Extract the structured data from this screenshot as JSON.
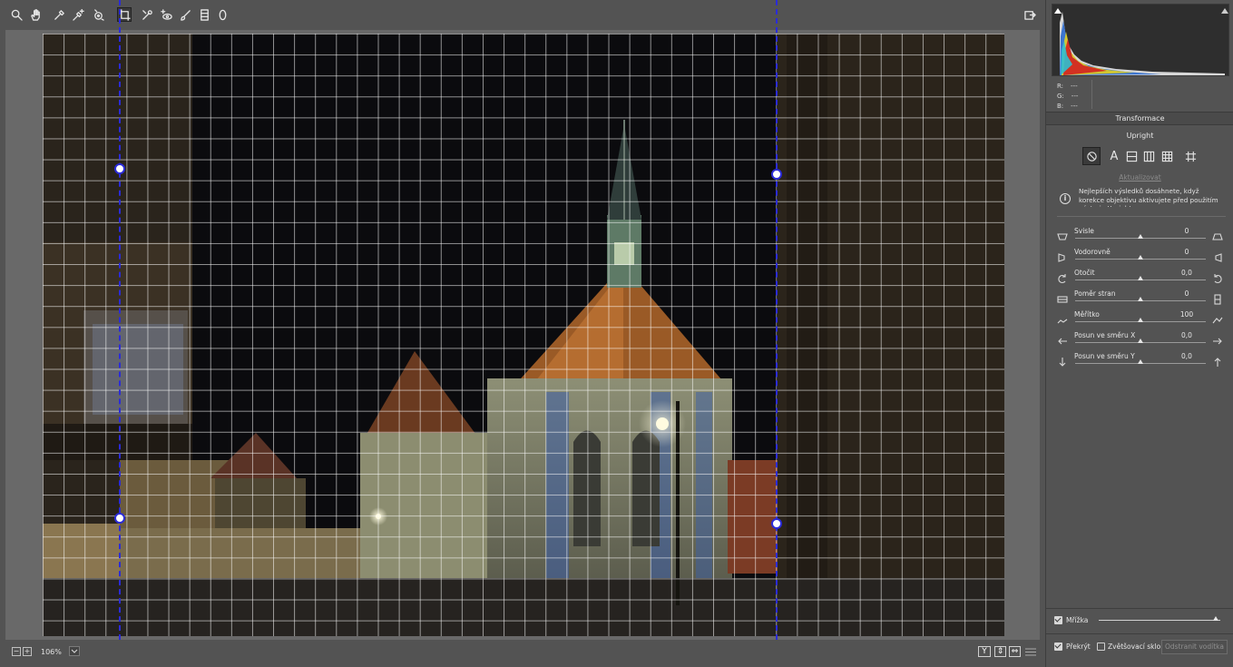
{
  "toolbar": {
    "tools": [
      {
        "id": "zoom-tool",
        "icon": "magnifier-icon"
      },
      {
        "id": "hand-tool",
        "icon": "hand-icon"
      },
      {
        "id": "white-balance-tool",
        "icon": "eyedropper-icon"
      },
      {
        "id": "color-sampler-tool",
        "icon": "eyedropper-plus-icon"
      },
      {
        "id": "targeted-adjustment-tool",
        "icon": "target-icon"
      },
      {
        "id": "transform-tool",
        "icon": "transform-icon",
        "active": true
      },
      {
        "id": "spot-removal-tool",
        "icon": "brush-x-icon"
      },
      {
        "id": "red-eye-tool",
        "icon": "eye-plus-icon"
      },
      {
        "id": "adjustment-brush-tool",
        "icon": "brush-icon"
      },
      {
        "id": "graduated-filter-tool",
        "icon": "gradient-rect-icon"
      },
      {
        "id": "radial-filter-tool",
        "icon": "ellipse-icon"
      }
    ],
    "open_icon": "open-in-photoshop-icon"
  },
  "bottom_bar": {
    "zoom_out": "−",
    "zoom_in": "+",
    "zoom_value": "106%",
    "view_buttons": [
      "Y",
      "⇕",
      "⇔"
    ],
    "settings_icon": "sliders-icon"
  },
  "histogram": {
    "rgb_labels": [
      "R:",
      "G:",
      "B:"
    ],
    "rgb_values": [
      "---",
      "---",
      "---"
    ]
  },
  "panel": {
    "tab_title": "Transformace",
    "upright_title": "Upright",
    "upright_buttons": [
      "off-icon",
      "auto-icon",
      "level-icon",
      "vertical-icon",
      "full-icon",
      "guided-icon"
    ],
    "upright_letter": "A",
    "update_link": "Aktualizovat",
    "info_text": "Nejlepších výsledků dosáhnete, když korekce objektivu aktivujete před použitím nástroje Upright.",
    "sliders": [
      {
        "label": "Svisle",
        "value": "0",
        "level": 0.5
      },
      {
        "label": "Vodorovně",
        "value": "0",
        "level": 0.5
      },
      {
        "label": "Otočit",
        "value": "0,0",
        "level": 0.5
      },
      {
        "label": "Poměr stran",
        "value": "0",
        "level": 0.5
      },
      {
        "label": "Měřítko",
        "value": "100",
        "level": 0.5
      },
      {
        "label": "Posun ve směru X",
        "value": "0,0",
        "level": 0.5
      },
      {
        "label": "Posun ve směru Y",
        "value": "0,0",
        "level": 0.5
      }
    ],
    "grid_checkbox": "Mřížka",
    "grid_level": 0.97,
    "overlay_checkbox": "Překrýt",
    "loupe_checkbox": "Zvětšovací sklo",
    "remove_guides_button": "Odstranit vodítka"
  },
  "colors": {
    "guide": "#2b2bd8",
    "background": "#535353",
    "canvas_bg": "#696969"
  }
}
